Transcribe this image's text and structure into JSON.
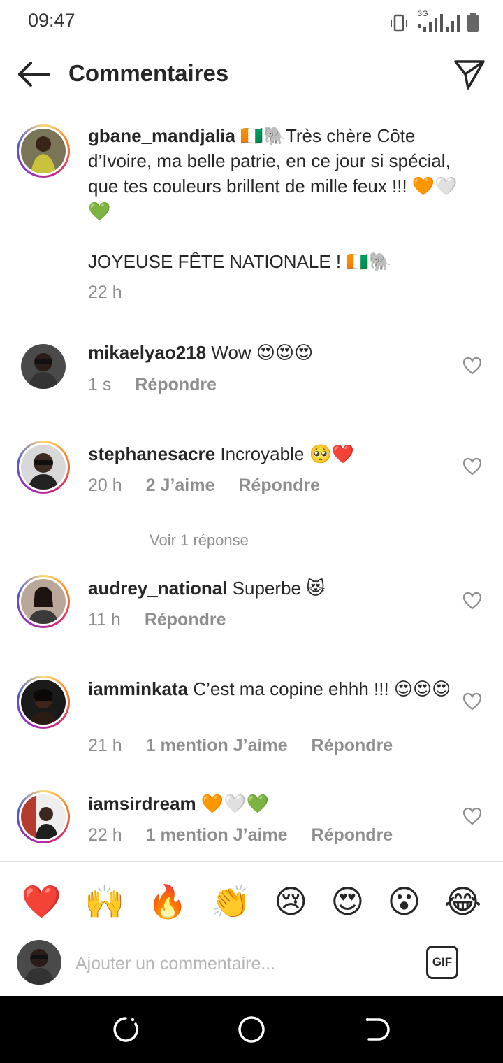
{
  "status_bar": {
    "time": "09:47",
    "network": "3G"
  },
  "header": {
    "title": "Commentaires"
  },
  "caption": {
    "username": "gbane_mandjalia",
    "text_line1": "🇨🇮🐘Très chère Côte d’Ivoire, ma belle patrie, en ce jour si spécial, que tes couleurs brillent de mille feux !!! 🧡🤍💚",
    "text_line2": "JOYEUSE FÊTE NATIONALE ! 🇨🇮🐘",
    "time": "22 h"
  },
  "comments": [
    {
      "username": "mikaelyao218",
      "text": "Wow 😍😍😍",
      "time": "1 s",
      "likes": "",
      "reply": "Répondre"
    },
    {
      "username": "stephanesacre",
      "text": "Incroyable 🥺❤️",
      "time": "20 h",
      "likes": "2 J’aime",
      "reply": "Répondre"
    },
    {
      "username": "audrey_national",
      "text": "Superbe 😻",
      "time": "11 h",
      "likes": "",
      "reply": "Répondre"
    },
    {
      "username": "iamminkata",
      "text": "C’est ma copine ehhh !!! 😍😍😍",
      "time": "21 h",
      "likes": "1 mention J’aime",
      "reply": "Répondre"
    },
    {
      "username": "iamsirdream",
      "text": "🧡🤍💚",
      "time": "22 h",
      "likes": "1 mention J’aime",
      "reply": "Répondre"
    }
  ],
  "view_replies": "Voir 1 réponse",
  "emoji_bar": [
    "❤️",
    "🙌",
    "🔥",
    "👏",
    "😢",
    "😍",
    "😮",
    "😂"
  ],
  "comment_input": {
    "placeholder": "Ajouter un commentaire..."
  },
  "gif_label": "GIF",
  "icons": {
    "back": "arrow-left-icon",
    "send": "paper-plane-icon",
    "like": "heart-outline-icon",
    "nav": [
      "recents-icon",
      "home-circle-icon",
      "back-nav-icon"
    ]
  }
}
